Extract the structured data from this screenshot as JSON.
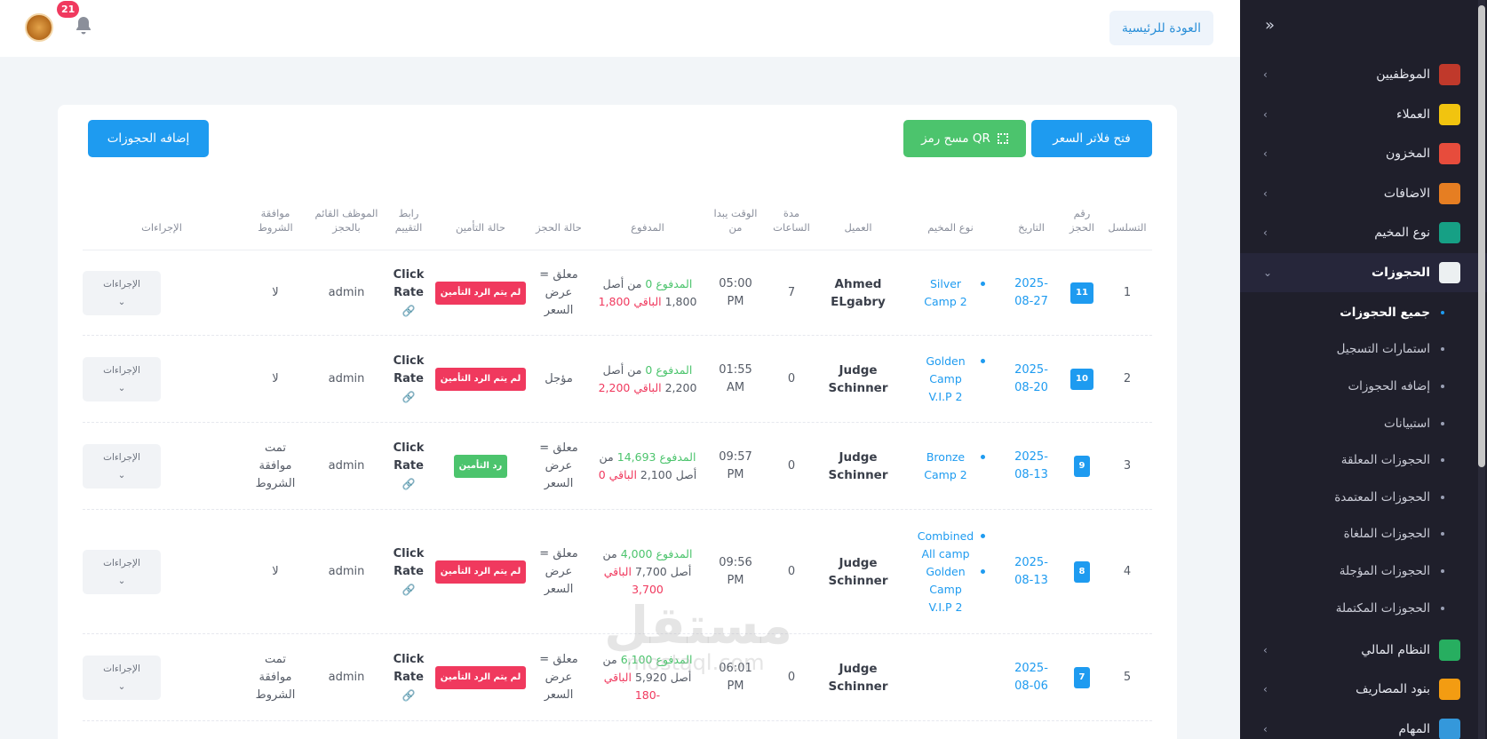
{
  "topbar": {
    "home_label": "العودة للرئيسية",
    "notification_count": "21"
  },
  "sidebar": {
    "collapse_icon": "double-chevron-right-icon",
    "items": [
      {
        "label": "الموظفيين",
        "icon": "employees-icon",
        "color": "#c0392b"
      },
      {
        "label": "العملاء",
        "icon": "clients-icon",
        "color": "#f1c40f"
      },
      {
        "label": "المخزون",
        "icon": "inventory-icon",
        "color": "#e74c3c"
      },
      {
        "label": "الاضافات",
        "icon": "additions-icon",
        "color": "#e67e22"
      },
      {
        "label": "نوع المخيم",
        "icon": "camp-type-icon",
        "color": "#16a085"
      },
      {
        "label": "الحجوزات",
        "icon": "calendar-icon",
        "color": "#ecf0f1",
        "active": true
      }
    ],
    "sub_items": [
      {
        "label": "جميع الحجوزات",
        "active": true
      },
      {
        "label": "استمارات التسجيل"
      },
      {
        "label": "إضافه الحجوزات"
      },
      {
        "label": "استبيانات"
      },
      {
        "label": "الحجوزات المعلقة"
      },
      {
        "label": "الحجوزات المعتمدة"
      },
      {
        "label": "الحجوزات الملغاة"
      },
      {
        "label": "الحجوزات المؤجلة"
      },
      {
        "label": "الحجوزات المكتملة"
      }
    ],
    "bottom_items": [
      {
        "label": "النظام المالي",
        "icon": "finance-icon",
        "color": "#27ae60"
      },
      {
        "label": "بنود المصاريف",
        "icon": "expenses-icon",
        "color": "#f39c12"
      },
      {
        "label": "المهام",
        "icon": "tasks-icon",
        "color": "#3498db"
      }
    ]
  },
  "toolbar": {
    "price_filter_label": "فتح فلاتر السعر",
    "qr_label": "مسح رمز QR",
    "add_booking_label": "إضافه الحجوزات"
  },
  "table": {
    "headers": {
      "serial": "التسلسل",
      "booking_no": "رقم الحجز",
      "date": "التاريخ",
      "camp_type": "نوع المخيم",
      "client": "العميل",
      "duration": "مدة الساعات",
      "start_time": "الوقت يبدا من",
      "paid": "المدفوع",
      "status": "حالة الحجز",
      "insurance": "حالة التأمين",
      "rating_link": "رابط التقييم",
      "employee": "الموظف القائم بالحجز",
      "terms": "موافقة الشروط",
      "actions": "الإجراءات"
    },
    "rows": [
      {
        "serial": "1",
        "booking_no": "11",
        "date": "2025-08-27",
        "camp": [
          "Silver Camp 2"
        ],
        "client": "Ahmed ELgabry",
        "duration": "7",
        "time": "05:00 PM",
        "paid_label": "المدفوع",
        "paid": "0",
        "of_label": "من أصل",
        "total": "1,800",
        "rem_label": "الباقي",
        "remaining": "1,800",
        "status": "معلق = عرض السعر",
        "insurance": "لم يتم الرد التأمين",
        "insurance_ok": false,
        "rate_label": "Click Rate",
        "employee": "admin",
        "terms": "لا",
        "actions_label": "الإجراءات"
      },
      {
        "serial": "2",
        "booking_no": "10",
        "date": "2025-08-20",
        "camp": [
          "Golden Camp V.I.P 2"
        ],
        "client": "Judge Schinner",
        "duration": "0",
        "time": "01:55 AM",
        "paid_label": "المدفوع",
        "paid": "0",
        "of_label": "من أصل",
        "total": "2,200",
        "rem_label": "الباقي",
        "remaining": "2,200",
        "status": "مؤجل",
        "insurance": "لم يتم الرد التأمين",
        "insurance_ok": false,
        "rate_label": "Click Rate",
        "employee": "admin",
        "terms": "لا",
        "actions_label": "الإجراءات"
      },
      {
        "serial": "3",
        "booking_no": "9",
        "date": "2025-08-13",
        "camp": [
          "Bronze Camp 2"
        ],
        "client": "Judge Schinner",
        "duration": "0",
        "time": "09:57 PM",
        "paid_label": "المدفوع",
        "paid": "14,693",
        "of_label": "من أصل",
        "total": "2,100",
        "rem_label": "الباقي",
        "remaining": "0",
        "status": "معلق = عرض السعر",
        "insurance": "رد التأمين",
        "insurance_ok": true,
        "rate_label": "Click Rate",
        "employee": "admin",
        "terms": "تمت موافقة الشروط",
        "actions_label": "الإجراءات"
      },
      {
        "serial": "4",
        "booking_no": "8",
        "date": "2025-08-13",
        "camp": [
          "Combined All camp",
          "Golden Camp V.I.P 2"
        ],
        "client": "Judge Schinner",
        "duration": "0",
        "time": "09:56 PM",
        "paid_label": "المدفوع",
        "paid": "4,000",
        "of_label": "من أصل",
        "total": "7,700",
        "rem_label": "الباقي",
        "remaining": "3,700",
        "status": "معلق = عرض السعر",
        "insurance": "لم يتم الرد التأمين",
        "insurance_ok": false,
        "rate_label": "Click Rate",
        "employee": "admin",
        "terms": "لا",
        "actions_label": "الإجراءات"
      },
      {
        "serial": "5",
        "booking_no": "7",
        "date": "2025-08-06",
        "camp": [],
        "client": "Judge Schinner",
        "duration": "0",
        "time": "06:01 PM",
        "paid_label": "المدفوع",
        "paid": "6,100",
        "of_label": "من أصل",
        "total": "5,920",
        "rem_label": "الباقي",
        "remaining": "-180",
        "status": "معلق = عرض السعر",
        "insurance": "لم يتم الرد التأمين",
        "insurance_ok": false,
        "rate_label": "Click Rate",
        "employee": "admin",
        "terms": "تمت موافقة الشروط",
        "actions_label": "الإجراءات"
      }
    ]
  },
  "watermark": {
    "main": "مستقل",
    "sub": "mostaql.com"
  }
}
